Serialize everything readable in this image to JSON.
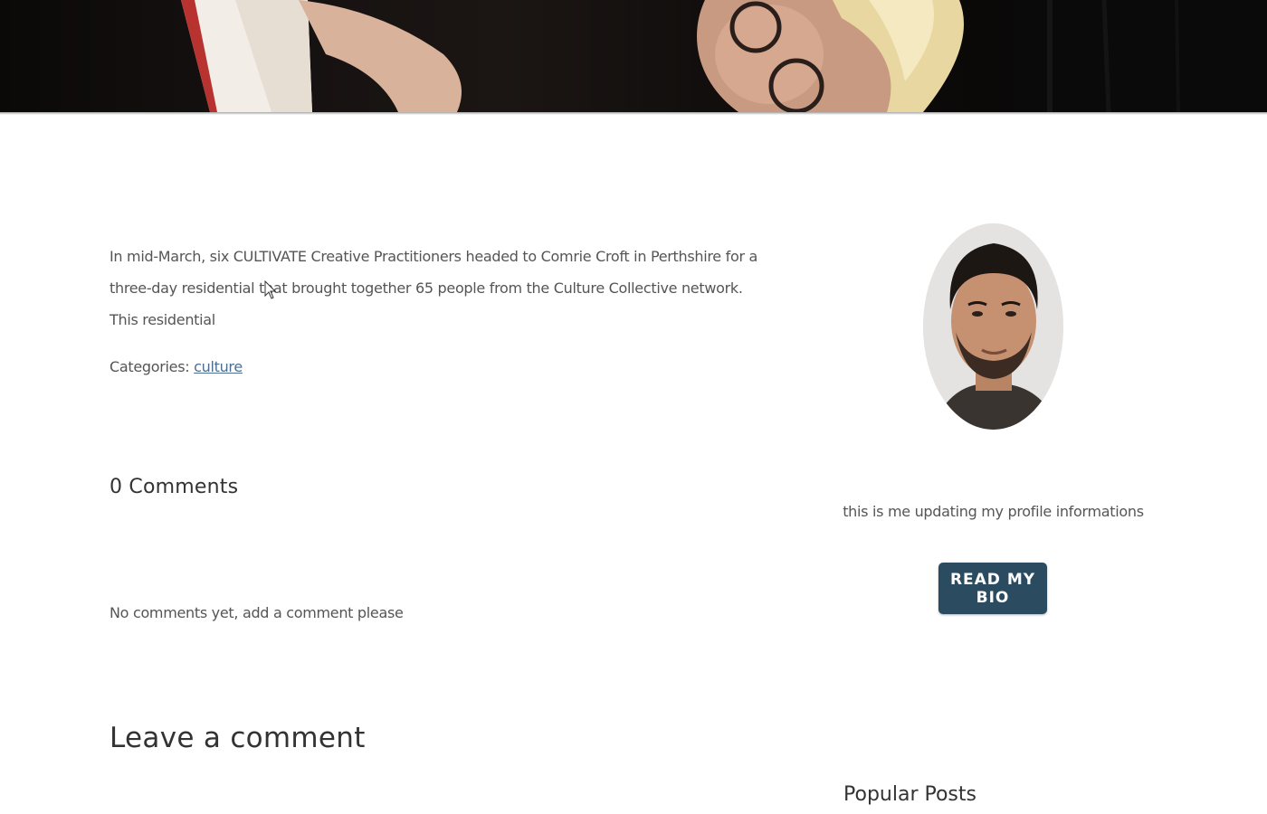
{
  "article": {
    "excerpt": "In mid-March, six CULTIVATE Creative Practitioners headed to Comrie Croft in Perthshire for a three-day residential that brought together 65 people from the Culture Collective network. This residential",
    "categories_label": "Categories: ",
    "category_link": "culture",
    "comments_count": "0 Comments",
    "no_comments_text": "No comments yet, add a comment please",
    "leave_comment_heading": "Leave a comment"
  },
  "sidebar": {
    "bio_text": "this is me updating my profile informations",
    "bio_button_label": "READ MY BIO",
    "popular_heading": "Popular Posts"
  },
  "colors": {
    "button_bg": "#2b4b61",
    "link": "#4d6e91"
  },
  "icons": {
    "cursor": "mouse-pointer-icon"
  }
}
